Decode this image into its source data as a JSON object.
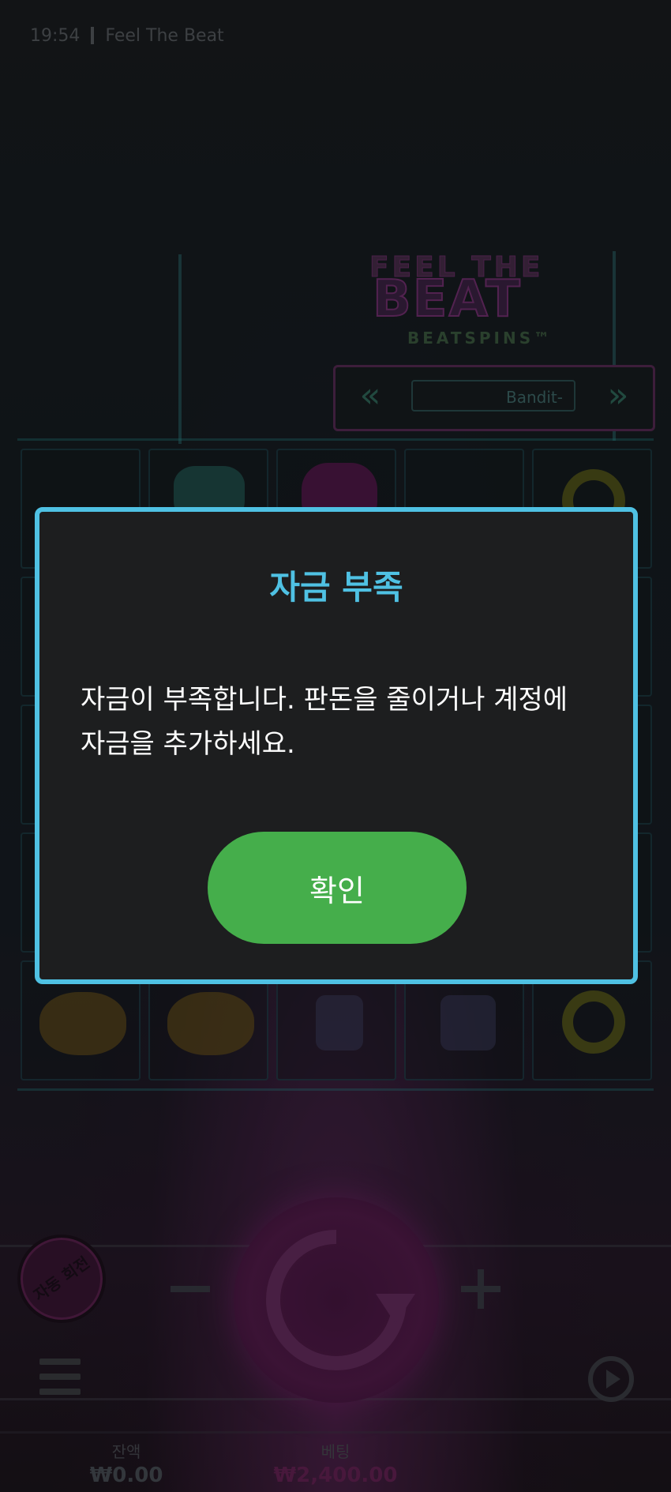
{
  "status_bar": {
    "time": "19:54",
    "app_name": "Feel The Beat"
  },
  "game": {
    "logo": {
      "line1": "FEEL THE",
      "line2": "BEAT",
      "line3": "BEATSPINS™"
    },
    "bandit_selector": {
      "label": "Bandit-"
    },
    "autoplay_label": "자동 회전",
    "balance": {
      "label": "잔액",
      "value": "₩0.00"
    },
    "bet": {
      "label": "베팅",
      "value": "₩2,400.00"
    }
  },
  "dialog": {
    "title": "자금 부족",
    "message": "자금이 부족합니다. 판돈을 줄이거나 계정에 자금을 추가하세요.",
    "confirm_label": "확인"
  },
  "colors": {
    "dialog_accent": "#4fc1e3",
    "confirm_button": "#45ae4b",
    "balance_text": "#4a4f55",
    "bet_text": "#6b1f55"
  },
  "icons": [
    "rewind-icon",
    "fast-forward-icon",
    "spin-icon",
    "menu-icon",
    "replay-icon",
    "minus-icon",
    "plus-icon"
  ]
}
